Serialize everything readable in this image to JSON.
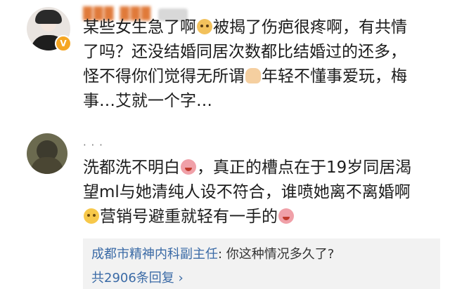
{
  "comment1": {
    "lines": [
      {
        "a": "某些女生急了啊",
        "b": "被揭了伤疤很疼啊，有共情"
      },
      {
        "a": "了吗？还没结婚同居次数都比结婚过的还多，"
      },
      {
        "a": "怪不得你们觉得无所谓",
        "b": "年轻不懂事爱玩，梅"
      },
      {
        "a": "事…艾就一个字…"
      }
    ],
    "badge": "V"
  },
  "comment2": {
    "username": "· · ·",
    "lines": [
      {
        "a": "洗都洗不明白",
        "b": "，真正的槽点在于19岁同居渴"
      },
      {
        "a": "望ml与她清纯人设不符合，谁喷她离不离婚啊"
      },
      {
        "a": "营销号避重就轻有一手的"
      }
    ]
  },
  "reply": {
    "author": "成都市精神内科副主任",
    "colon": ":",
    "text": " 你这种情况多久了?",
    "count_text": "共2906条回复",
    "chevron": "›"
  },
  "icons": [
    "dog-emoji-icon",
    "thumb-emoji-icon",
    "laugh-emoji-icon",
    "think-emoji-icon",
    "verified-icon"
  ]
}
